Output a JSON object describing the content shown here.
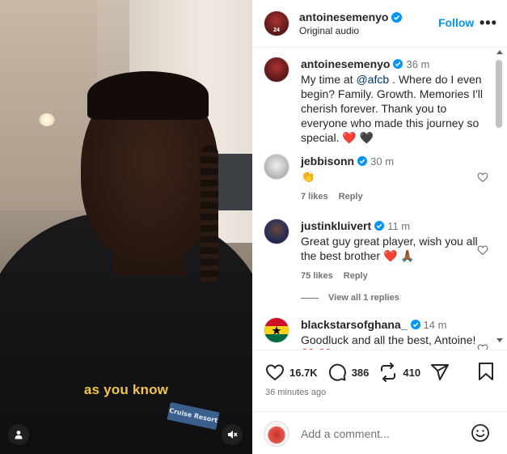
{
  "media": {
    "caption": "as you know",
    "shirt_text": "Cruise Resort"
  },
  "header": {
    "username": "antoinesemenyo",
    "subtitle": "Original audio",
    "follow_label": "Follow",
    "more_label": "•••",
    "avatar_number": "24"
  },
  "caption_post": {
    "username": "antoinesemenyo",
    "time": "36 m",
    "text_before": "My time at ",
    "mention": "@afcb",
    "text_after": " . Where do I even begin? Family. Growth. Memories I'll cherish forever. Thank you to everyone who made this journey so special. ❤️ 🖤"
  },
  "comments": [
    {
      "username": "jebbisonn",
      "time": "30 m",
      "text": "👏",
      "likes": "7 likes",
      "reply": "Reply"
    },
    {
      "username": "justinkluivert",
      "time": "11 m",
      "text": "Great guy great player, wish you all the best brother ❤️ 🙏🏾",
      "likes": "75 likes",
      "reply": "Reply"
    },
    {
      "username": "blackstarsofghana_",
      "time": "14 m",
      "text": "Goodluck and all the best, Antoine! ❤️ ❤️",
      "likes": "",
      "reply": ""
    }
  ],
  "view_replies": "View all 1 replies",
  "footer": {
    "like_count": "16.7K",
    "comment_count": "386",
    "repost_count": "410",
    "time_ago": "36 minutes ago",
    "add_comment_placeholder": "Add a comment..."
  },
  "colors": {
    "accent": "#0095f6",
    "caption_yellow": "#f4c542",
    "heart": "#ff3040"
  }
}
